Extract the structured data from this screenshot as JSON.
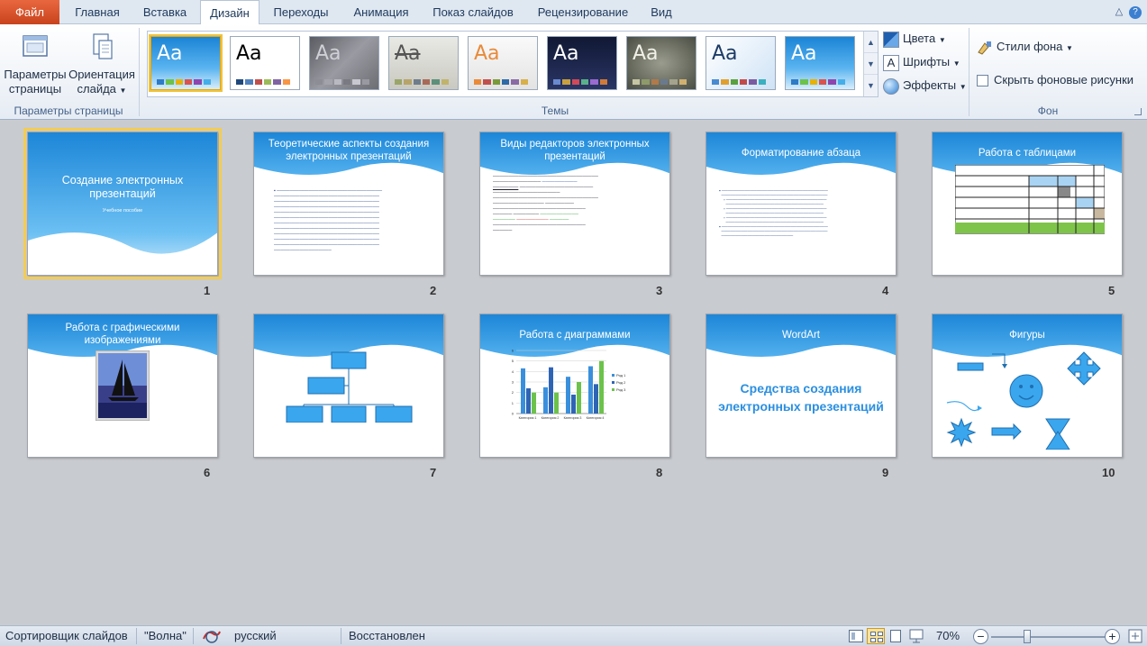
{
  "tabs": {
    "file": "Файл",
    "items": [
      "Главная",
      "Вставка",
      "Дизайн",
      "Переходы",
      "Анимация",
      "Показ слайдов",
      "Рецензирование",
      "Вид"
    ],
    "active": "Дизайн"
  },
  "ribbon": {
    "page_setup": {
      "btn_params": "Параметры\nстраницы",
      "btn_params_l1": "Параметры",
      "btn_params_l2": "страницы",
      "btn_orient_l1": "Ориентация",
      "btn_orient_l2": "слайда",
      "group_label": "Параметры страницы"
    },
    "themes": {
      "group_label": "Темы",
      "thumb_text": "Aa",
      "colors": "Цвета",
      "fonts": "Шрифты",
      "effects": "Эффекты"
    },
    "background": {
      "styles": "Стили фона",
      "hide_graphics": "Скрыть фоновые рисунки",
      "group_label": "Фон"
    }
  },
  "slides": [
    {
      "n": "1",
      "title": "Создание электронных презентаций",
      "subtitle": "Учебное пособие"
    },
    {
      "n": "2",
      "title": "Теоретические аспекты создания электронных презентаций"
    },
    {
      "n": "3",
      "title": "Виды редакторов электронных презентаций"
    },
    {
      "n": "4",
      "title": "Форматирование абзаца"
    },
    {
      "n": "5",
      "title": "Работа с таблицами"
    },
    {
      "n": "6",
      "title": "Работа с графическими изображениями"
    },
    {
      "n": "7",
      "title": ""
    },
    {
      "n": "8",
      "title": "Работа с диаграммами"
    },
    {
      "n": "9",
      "title": "WordArt",
      "wordart": "Средства создания электронных презентаций"
    },
    {
      "n": "10",
      "title": "Фигуры"
    }
  ],
  "chart8": {
    "categories": [
      "Категория 1",
      "Категория 2",
      "Категория 3",
      "Категория 4"
    ],
    "series": [
      {
        "name": "Ряд 1",
        "values": [
          4.3,
          2.5,
          3.5,
          4.5
        ],
        "color": "#3a8fdc"
      },
      {
        "name": "Ряд 2",
        "values": [
          2.4,
          4.4,
          1.8,
          2.8
        ],
        "color": "#2f64b5"
      },
      {
        "name": "Ряд 3",
        "values": [
          2,
          2,
          3,
          5
        ],
        "color": "#6cc24a"
      }
    ],
    "yticks": [
      "0",
      "1",
      "2",
      "3",
      "4",
      "5",
      "6"
    ]
  },
  "status": {
    "view": "Сортировщик слайдов",
    "theme": "\"Волна\"",
    "language": "русский",
    "state": "Восстановлен",
    "zoom": "70%"
  },
  "colors": {
    "accent": "#3d9be9",
    "file_tab": "#d5532a",
    "selection": "#f2cc55"
  }
}
